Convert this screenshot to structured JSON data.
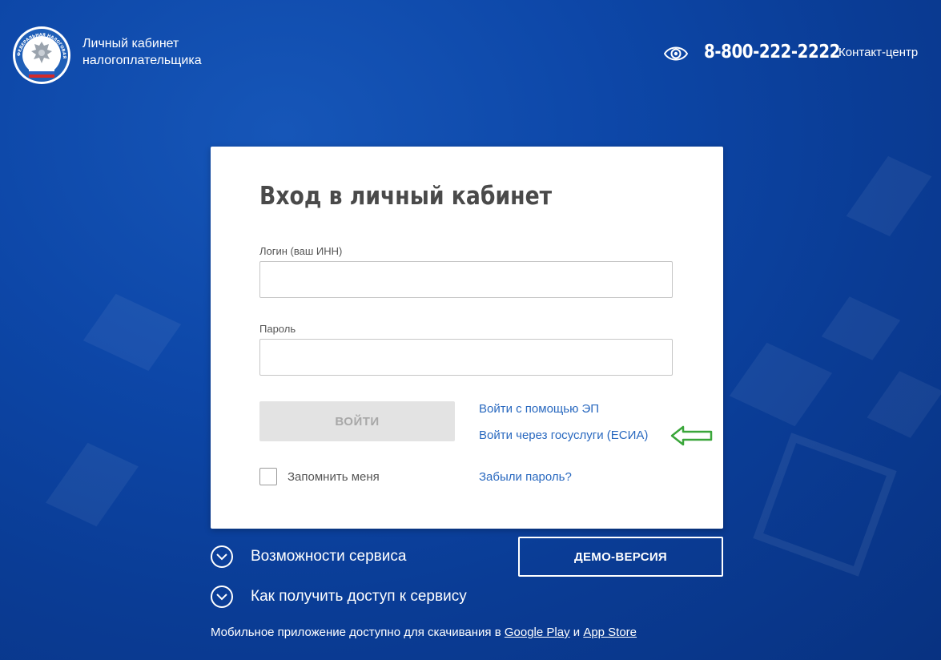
{
  "header": {
    "brand_title": "Личный кабинет налогоплательщика",
    "phone": "8-800-222-2222",
    "contact_link": "Контакт-центр",
    "logo_text": "ФЕДЕРАЛЬНАЯ НАЛОГОВАЯ СЛУЖБА"
  },
  "login": {
    "title": "Вход в личный кабинет",
    "login_label": "Логин (ваш ИНН)",
    "login_value": "",
    "password_label": "Пароль",
    "password_value": "",
    "submit_label": "ВОЙТИ",
    "ep_link": "Войти с помощью ЭП",
    "esia_link": "Войти через госуслуги (ЕСИА)",
    "remember_label": "Запомнить меня",
    "forgot_link": "Забыли пароль?"
  },
  "extras": {
    "features_label": "Возможности сервиса",
    "access_label": "Как получить доступ к сервису",
    "demo_label": "ДЕМО-ВЕРСИЯ",
    "mobile_prefix": "Мобильное приложение доступно для скачивания в",
    "google_play": "Google Play",
    "and_word": "и",
    "app_store": "App Store"
  },
  "icons": {
    "eye": "eye-icon",
    "arrow": "arrow-left-icon",
    "chevron": "chevron-down-icon"
  },
  "colors": {
    "link": "#2868bf",
    "arrow": "#3aa63a",
    "background": "#0d47a8",
    "button_disabled": "#e3e3e3"
  }
}
